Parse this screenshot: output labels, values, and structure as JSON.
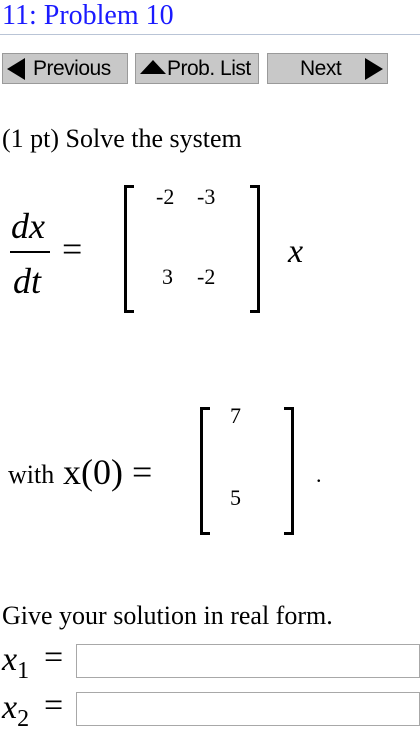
{
  "header": {
    "title": "11: Problem 10"
  },
  "nav": {
    "previous_label": "Previous",
    "prob_list_label": "Prob. List",
    "next_label": "Next"
  },
  "problem": {
    "prompt": "(1 pt) Solve the system",
    "lhs_numerator": "dx",
    "lhs_denominator": "dt",
    "equals": "=",
    "matrix": {
      "r1c1": "-2",
      "r1c2": "-3",
      "r2c1": "3",
      "r2c2": "-2"
    },
    "rhs_variable": "x",
    "with_label": "with",
    "initial_lhs": "x(0) =",
    "initial_vector": {
      "v1": "7",
      "v2": "5"
    },
    "period": ".",
    "instruction": "Give your solution in real form."
  },
  "answers": {
    "x1_var": "x",
    "x1_sub": "1",
    "x1_value": "",
    "x2_var": "x",
    "x2_sub": "2",
    "x2_value": "",
    "equals": "="
  },
  "colors": {
    "title": "#1a1aff",
    "button_bg": "#c8c8c8",
    "rule": "#b9c4d6"
  }
}
